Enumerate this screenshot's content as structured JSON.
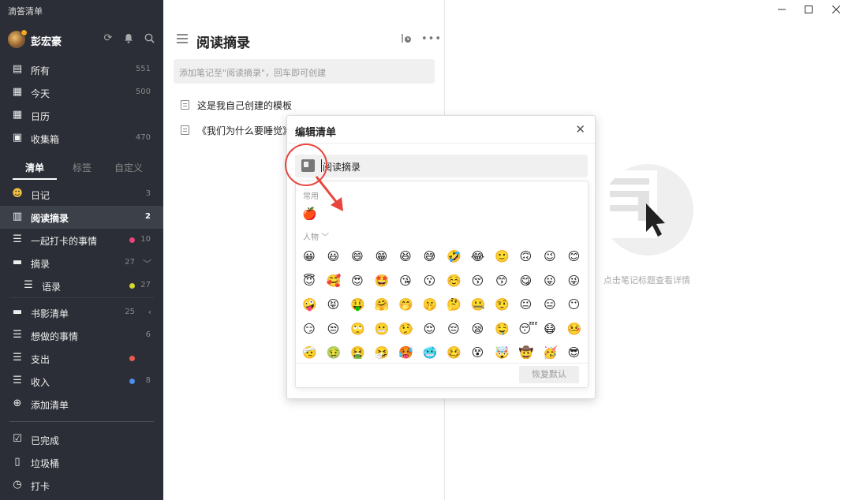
{
  "app_title": "滴答清单",
  "user": {
    "name": "彭宏豪"
  },
  "header_icons": [
    "sync-icon",
    "bell-icon",
    "search-icon"
  ],
  "smart_lists": [
    {
      "label": "所有",
      "count": "551",
      "icon": "inbox-icon"
    },
    {
      "label": "今天",
      "count": "500",
      "icon": "calendar-today-icon"
    },
    {
      "label": "日历",
      "count": "",
      "icon": "calendar-icon"
    },
    {
      "label": "收集箱",
      "count": "470",
      "icon": "collect-box-icon"
    }
  ],
  "tabs": [
    "清单",
    "标签",
    "自定义"
  ],
  "lists": [
    {
      "label": "日记",
      "count": "3",
      "icon": "emoji-icon",
      "dot": ""
    },
    {
      "label": "阅读摘录",
      "count": "2",
      "icon": "book-icon",
      "dot": "",
      "active": true
    },
    {
      "label": "一起打卡的事情",
      "count": "10",
      "icon": "list-icon",
      "dot": "#e8457a"
    },
    {
      "label": "摘录",
      "count": "27",
      "icon": "folder-icon",
      "dot": "",
      "chev": "﹀"
    },
    {
      "label": "语录",
      "count": "27",
      "icon": "list-icon",
      "dot": "#d4d432",
      "indent": true
    },
    {
      "label": "书影清单",
      "count": "25",
      "icon": "folder-icon",
      "dot": "",
      "chev": "‹"
    },
    {
      "label": "想做的事情",
      "count": "6",
      "icon": "list-icon",
      "dot": ""
    },
    {
      "label": "支出",
      "count": "",
      "icon": "list-icon",
      "dot": "#e85a4f"
    },
    {
      "label": "收入",
      "count": "8",
      "icon": "list-icon",
      "dot": "#4a8ee8"
    },
    {
      "label": "添加清单",
      "count": "",
      "icon": "add-icon",
      "dot": ""
    }
  ],
  "bottom_items": [
    {
      "label": "已完成",
      "icon": "checkbox-icon"
    },
    {
      "label": "垃圾桶",
      "icon": "trash-icon"
    },
    {
      "label": "打卡",
      "icon": "clock-icon"
    }
  ],
  "main": {
    "title": "阅读摘录",
    "add_placeholder": "添加笔记至\"阅读摘录\"，回车即可创建",
    "tasks": [
      "这是我自己创建的模板",
      "《我们为什么要睡觉》"
    ]
  },
  "detail": {
    "empty_text": "点击笔记标题查看详情"
  },
  "dialog": {
    "title": "编辑清单",
    "name_value": "阅读摘录",
    "section_common": "常用",
    "common_emoji": [
      "🍎"
    ],
    "section_people": "人物 ﹀",
    "people_emoji": [
      "😀",
      "😃",
      "😄",
      "😁",
      "😆",
      "😅",
      "🤣",
      "😂",
      "🙂",
      "🙃",
      "😉",
      "😊",
      "😇",
      "🥰",
      "😍",
      "🤩",
      "😘",
      "😗",
      "☺️",
      "😚",
      "😙",
      "😋",
      "😛",
      "😜",
      "🤪",
      "😝",
      "🤑",
      "🤗",
      "🤭",
      "🤫",
      "🤔",
      "🤐",
      "🤨",
      "😐",
      "😑",
      "😶",
      "😏",
      "😒",
      "🙄",
      "😬",
      "🤥",
      "😌",
      "😔",
      "😪",
      "🤤",
      "😴",
      "😷",
      "🤒",
      "🤕",
      "🤢",
      "🤮",
      "🤧",
      "🥵",
      "🥶",
      "🥴",
      "😵",
      "🤯",
      "🤠",
      "🥳",
      "😎"
    ],
    "reset_label": "恢复默认"
  }
}
